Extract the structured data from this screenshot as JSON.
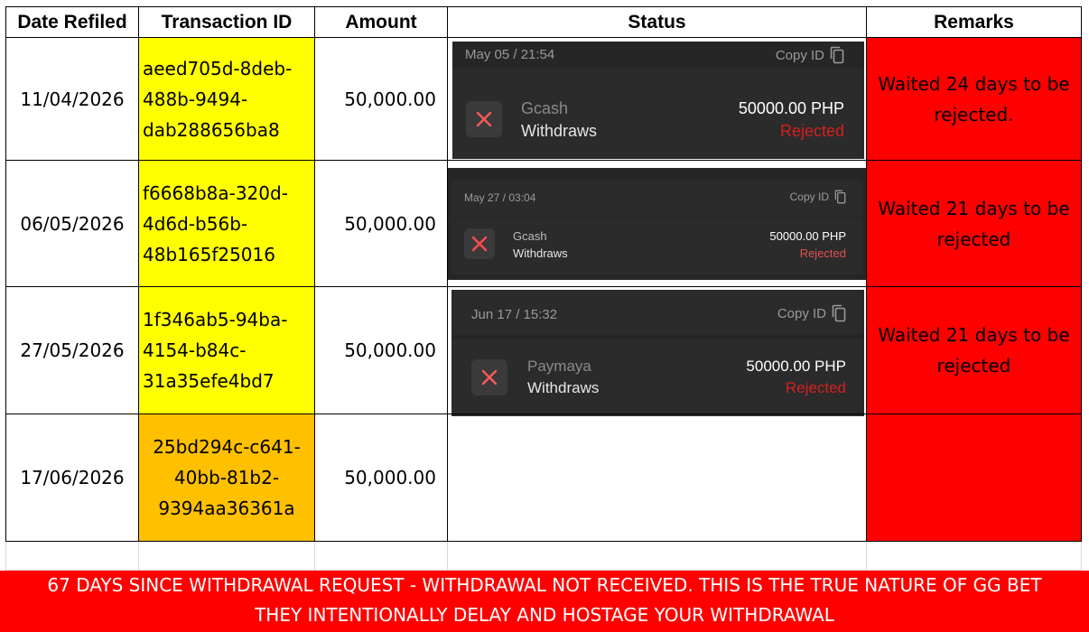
{
  "headers": {
    "date": "Date Refiled",
    "transaction_id": "Transaction ID",
    "amount": "Amount",
    "status": "Status",
    "remarks": "Remarks"
  },
  "rows": [
    {
      "date": "11/04/2026",
      "tid_lines": [
        "aeed705d-8deb-",
        "488b-9494-",
        "dab288656ba8"
      ],
      "amount": "50,000.00",
      "remark_lines": [
        "Waited 24 days to be",
        "rejected."
      ],
      "status": {
        "timestamp": "May 05 / 21:54",
        "copy_label": "Copy ID",
        "provider": "Gcash",
        "kind": "Withdraws",
        "amount": "50000.00 PHP",
        "state": "Rejected"
      }
    },
    {
      "date": "06/05/2026",
      "tid_lines": [
        "f6668b8a-320d-",
        "4d6d-b56b-",
        "48b165f25016"
      ],
      "amount": "50,000.00",
      "remark_lines": [
        "Waited 21 days to be",
        "rejected"
      ],
      "status": {
        "timestamp": "May 27 / 03:04",
        "copy_label": "Copy ID",
        "provider": "Gcash",
        "kind": "Withdraws",
        "amount": "50000.00 PHP",
        "state": "Rejected"
      }
    },
    {
      "date": "27/05/2026",
      "tid_lines": [
        "1f346ab5-94ba-",
        "4154-b84c-",
        "31a35efe4bd7"
      ],
      "amount": "50,000.00",
      "remark_lines": [
        "Waited 21 days to be",
        "rejected"
      ],
      "status": {
        "timestamp": "Jun 17 / 15:32",
        "copy_label": "Copy ID",
        "provider": "Paymaya",
        "kind": "Withdraws",
        "amount": "50000.00 PHP",
        "state": "Rejected"
      }
    },
    {
      "date": "17/06/2026",
      "tid_lines": [
        "25bd294c-c641-",
        "40bb-81b2-",
        "9394aa36361a"
      ],
      "amount": "50,000.00",
      "remark_lines": [
        "",
        ""
      ]
    }
  ],
  "colors": {
    "yellow": "#ffff00",
    "orange": "#ffc000",
    "red": "#ff0000",
    "rejected": "#d61f1f"
  },
  "icons": {
    "reject": "x-mark-icon",
    "copy": "copy-icon"
  },
  "banner": {
    "line1": "67 DAYS SINCE WITHDRAWAL REQUEST  - WITHDRAWAL NOT RECEIVED. THIS IS THE TRUE NATURE OF GG BET",
    "line2": "THEY INTENTIONALLY DELAY AND HOSTAGE YOUR WITHDRAWAL"
  }
}
